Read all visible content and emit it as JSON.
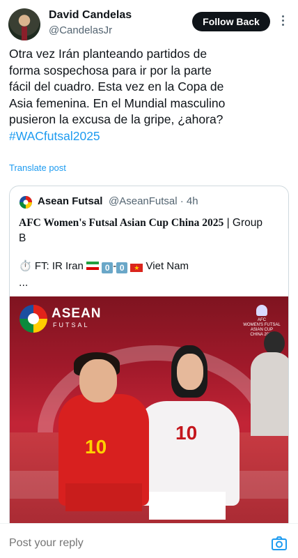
{
  "author": {
    "display_name": "David Candelas",
    "handle": "@CandelasJr",
    "follow_label": "Follow Back"
  },
  "tweet": {
    "text_lines": [
      "Otra vez Irán planteando partidos de",
      "forma sospechosa para ir por la parte",
      "fácil del cuadro. Esta vez en la Copa de",
      "Asia femenina. En el Mundial masculino",
      "pusieron la excusa de la gripe, ¿ahora?"
    ],
    "hashtag": "#WACfutsal2025",
    "translate_label": "Translate post"
  },
  "quote": {
    "name": "Asean Futsal",
    "handle_time": "@AseanFutsal · 4h",
    "title_bold": "AFC Women's Futsal Asian Cup China 2025",
    "title_rest": " | Group",
    "title_line2": "B",
    "score_prefix": "⏱️ FT: IR Iran",
    "score_home": "0",
    "score_sep": "-",
    "score_away": "0",
    "score_team2": "Viet Nam",
    "ellipsis": "...",
    "media": {
      "brand": "ASEAN",
      "brand_sub": "FUTSAL",
      "cup_line1": "AFC",
      "cup_line2": "WOMEN'S FUTSAL",
      "cup_line3": "ASIAN CUP",
      "cup_line4": "CHINA 2025",
      "red_player_number": "10",
      "white_player_number": "10"
    }
  },
  "reply": {
    "placeholder": "Post your reply"
  },
  "colors": {
    "accent": "#1d9bf0",
    "text": "#0f1419",
    "muted": "#536471",
    "border": "#cfd9de"
  },
  "icons": {
    "more": "more-icon",
    "logo": "asean-futsal-logo-icon",
    "camera": "camera-icon"
  }
}
